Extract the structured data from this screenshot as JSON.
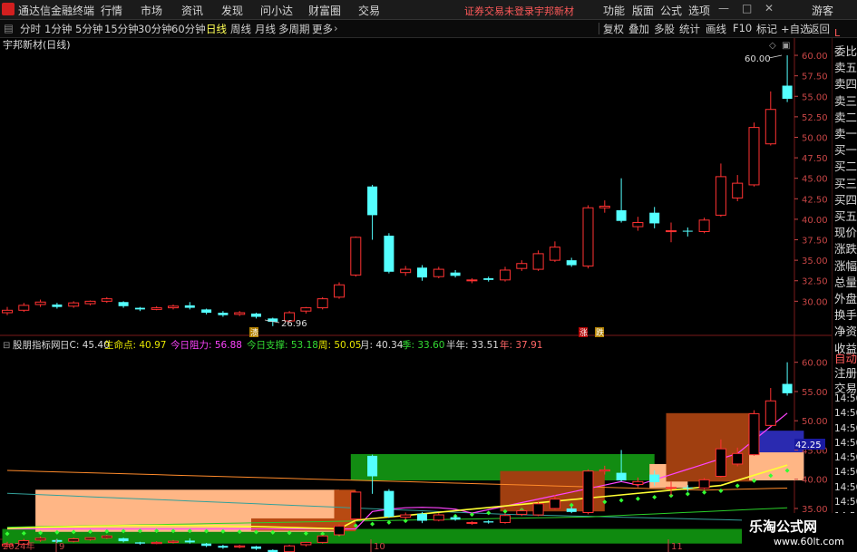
{
  "menubar": {
    "app_title": "通达信金融终端",
    "items": [
      "行情",
      "市场",
      "资讯",
      "发现",
      "问小达",
      "财富圈",
      "交易"
    ],
    "status_text": "证券交易未登录",
    "stock_name": "宇邦新材",
    "right_items": [
      "功能",
      "版面",
      "公式",
      "选项"
    ],
    "guest": "游客"
  },
  "periodbar": {
    "periods": [
      "分时",
      "1分钟",
      "5分钟",
      "15分钟",
      "30分钟",
      "60分钟",
      "日线",
      "周线",
      "月线",
      "多周期",
      "更多"
    ],
    "active": "日线",
    "tools": [
      "复权",
      "叠加",
      "多股",
      "统计",
      "画线",
      "F10",
      "标记",
      "+自选",
      "返回"
    ]
  },
  "main_chart": {
    "title": "宇邦新材(日线)",
    "y_ticks": [
      "60.00",
      "57.50",
      "55.00",
      "52.50",
      "50.00",
      "47.50",
      "45.00",
      "42.50",
      "40.00",
      "37.50",
      "35.00",
      "32.50",
      "30.00"
    ],
    "high_label": "60.00",
    "low_label": "26.96",
    "event_markers": [
      "涨",
      "跌"
    ]
  },
  "indicator": {
    "name": "股朋指标网",
    "fields": [
      {
        "label": "日C: 45.40",
        "color": "#dcdcdc"
      },
      {
        "label": "生命点: 40.97",
        "color": "#e6e600"
      },
      {
        "label": "今日阻力: 56.88",
        "color": "#ff44ff"
      },
      {
        "label": "今日支撑: 53.18",
        "color": "#33dd33"
      },
      {
        "label": "周: 50.05",
        "color": "#e6e600"
      },
      {
        "label": "月: 40.34",
        "color": "#dcdcdc"
      },
      {
        "label": "季: 33.60",
        "color": "#33dd33"
      },
      {
        "label": "半年: 33.51",
        "color": "#dcdcdc"
      },
      {
        "label": "年: 37.91",
        "color": "#ff6666"
      }
    ],
    "y_ticks": [
      "60.00",
      "55.00",
      "50.00",
      "45.00",
      "40.00",
      "35.00"
    ],
    "value_label": "42.25"
  },
  "x_axis": {
    "labels": [
      "2024年",
      "9",
      "10",
      "11"
    ]
  },
  "right_panel": {
    "items": [
      "L",
      "委比",
      "卖五",
      "卖四",
      "卖三",
      "卖二",
      "卖一",
      "买一",
      "买二",
      "买三",
      "买四",
      "买五",
      "现价",
      "涨跌",
      "涨幅",
      "总量",
      "外盘",
      "换手",
      "净资",
      "收益"
    ],
    "lower_items": [
      "自动",
      "注册",
      "交易",
      "14:50",
      "14:50",
      "14:50",
      "14:50",
      "14:50",
      "14:50",
      "14:50",
      "14:50",
      "14:50"
    ]
  },
  "watermark": {
    "name": "乐淘公式网",
    "url": "www.60lt.com"
  },
  "chart_data": {
    "type": "candlestick",
    "title": "宇邦新材(日线)",
    "ylim": [
      26.5,
      61
    ],
    "candles": [
      {
        "o": 28.6,
        "c": 28.9,
        "h": 29.3,
        "l": 28.3
      },
      {
        "o": 28.9,
        "c": 29.5,
        "h": 29.8,
        "l": 28.7
      },
      {
        "o": 29.6,
        "c": 29.9,
        "h": 30.2,
        "l": 29.3
      },
      {
        "o": 29.6,
        "c": 29.3,
        "h": 29.8,
        "l": 29.1
      },
      {
        "o": 29.4,
        "c": 29.8,
        "h": 30.0,
        "l": 29.2
      },
      {
        "o": 29.7,
        "c": 30.0,
        "h": 30.1,
        "l": 29.5
      },
      {
        "o": 30.0,
        "c": 30.3,
        "h": 30.5,
        "l": 29.8
      },
      {
        "o": 29.9,
        "c": 29.4,
        "h": 30.0,
        "l": 29.2
      },
      {
        "o": 29.2,
        "c": 29.0,
        "h": 29.3,
        "l": 28.8
      },
      {
        "o": 29.0,
        "c": 29.2,
        "h": 29.4,
        "l": 28.9
      },
      {
        "o": 29.2,
        "c": 29.4,
        "h": 29.6,
        "l": 29.0
      },
      {
        "o": 29.5,
        "c": 29.2,
        "h": 29.9,
        "l": 29.0
      },
      {
        "o": 29.0,
        "c": 28.6,
        "h": 29.1,
        "l": 28.4
      },
      {
        "o": 28.6,
        "c": 28.3,
        "h": 28.8,
        "l": 28.1
      },
      {
        "o": 28.4,
        "c": 28.6,
        "h": 28.8,
        "l": 28.2
      },
      {
        "o": 28.5,
        "c": 28.1,
        "h": 28.6,
        "l": 27.9
      },
      {
        "o": 27.9,
        "c": 27.5,
        "h": 28.0,
        "l": 26.96
      },
      {
        "o": 27.6,
        "c": 28.6,
        "h": 28.8,
        "l": 27.4
      },
      {
        "o": 28.8,
        "c": 29.2,
        "h": 29.3,
        "l": 28.5
      },
      {
        "o": 29.2,
        "c": 30.3,
        "h": 30.5,
        "l": 29.0
      },
      {
        "o": 30.5,
        "c": 32.0,
        "h": 32.3,
        "l": 30.3
      },
      {
        "o": 33.2,
        "c": 37.8,
        "h": 37.9,
        "l": 33.0
      },
      {
        "o": 44.0,
        "c": 40.5,
        "h": 44.2,
        "l": 37.5
      },
      {
        "o": 38.0,
        "c": 33.6,
        "h": 38.3,
        "l": 33.4
      },
      {
        "o": 33.5,
        "c": 33.9,
        "h": 34.3,
        "l": 33.1
      },
      {
        "o": 34.1,
        "c": 32.9,
        "h": 34.4,
        "l": 32.5
      },
      {
        "o": 33.0,
        "c": 33.9,
        "h": 34.2,
        "l": 32.8
      },
      {
        "o": 33.5,
        "c": 33.1,
        "h": 33.8,
        "l": 32.9
      },
      {
        "o": 32.6,
        "c": 32.6,
        "h": 32.8,
        "l": 32.2
      },
      {
        "o": 32.8,
        "c": 32.6,
        "h": 33.0,
        "l": 32.4
      },
      {
        "o": 32.6,
        "c": 33.8,
        "h": 34.2,
        "l": 32.4
      },
      {
        "o": 34.0,
        "c": 34.6,
        "h": 35.0,
        "l": 33.7
      },
      {
        "o": 33.9,
        "c": 35.8,
        "h": 36.2,
        "l": 33.7
      },
      {
        "o": 35.0,
        "c": 36.6,
        "h": 37.3,
        "l": 34.8
      },
      {
        "o": 35.0,
        "c": 34.4,
        "h": 35.3,
        "l": 34.2
      },
      {
        "o": 34.3,
        "c": 41.4,
        "h": 41.7,
        "l": 34.0
      },
      {
        "o": 41.4,
        "c": 41.6,
        "h": 42.3,
        "l": 40.8
      },
      {
        "o": 41.1,
        "c": 39.8,
        "h": 45.0,
        "l": 39.6
      },
      {
        "o": 39.1,
        "c": 39.6,
        "h": 40.3,
        "l": 38.6
      },
      {
        "o": 40.8,
        "c": 39.5,
        "h": 41.5,
        "l": 38.9
      },
      {
        "o": 38.6,
        "c": 38.6,
        "h": 39.6,
        "l": 37.2
      },
      {
        "o": 38.6,
        "c": 38.5,
        "h": 39.0,
        "l": 37.9
      },
      {
        "o": 38.5,
        "c": 39.9,
        "h": 40.2,
        "l": 38.3
      },
      {
        "o": 40.5,
        "c": 45.2,
        "h": 46.8,
        "l": 40.3
      },
      {
        "o": 42.6,
        "c": 44.4,
        "h": 45.4,
        "l": 42.2
      },
      {
        "o": 44.2,
        "c": 51.2,
        "h": 51.8,
        "l": 44.0
      },
      {
        "o": 49.2,
        "c": 53.4,
        "h": 55.6,
        "l": 49.0
      },
      {
        "o": 56.3,
        "c": 54.7,
        "h": 60.0,
        "l": 54.3
      }
    ],
    "indicator_lines": {
      "生命点": 40.97,
      "今日阻力": 56.88,
      "今日支撑": 53.18,
      "周": 50.05,
      "月": 40.34,
      "季": 33.6,
      "半年": 33.51,
      "年": 37.91
    }
  }
}
